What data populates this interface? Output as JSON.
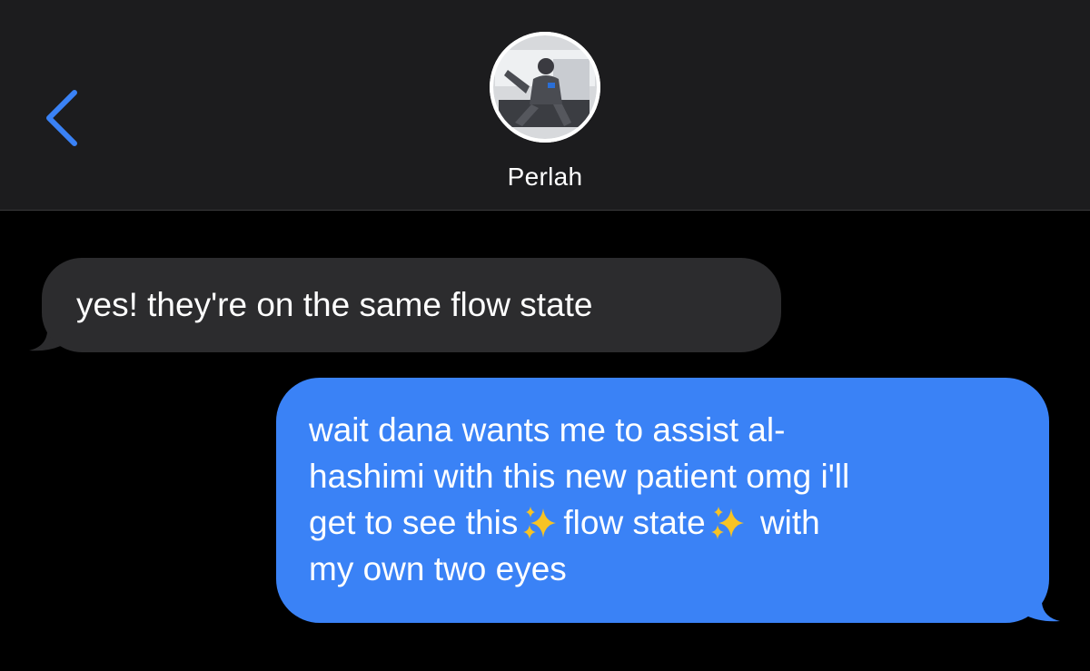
{
  "header": {
    "contact_name": "Perlah",
    "back_icon": "chevron-left-icon",
    "avatar_icon": "contact-avatar"
  },
  "colors": {
    "header_bg": "#1c1c1e",
    "screen_bg": "#000000",
    "incoming_bubble": "#2c2c2e",
    "outgoing_bubble": "#3a82f6",
    "accent": "#3a82f6",
    "sparkle": "#f7c325"
  },
  "messages": [
    {
      "direction": "incoming",
      "text": "yes! they're on the same flow state"
    },
    {
      "direction": "outgoing",
      "lines": [
        "wait dana wants me to assist al-",
        "hashimi with this new patient omg i'll",
        "get to see this",
        "flow state",
        "with",
        "my own two eyes"
      ],
      "emoji": "sparkles-icon"
    }
  ]
}
